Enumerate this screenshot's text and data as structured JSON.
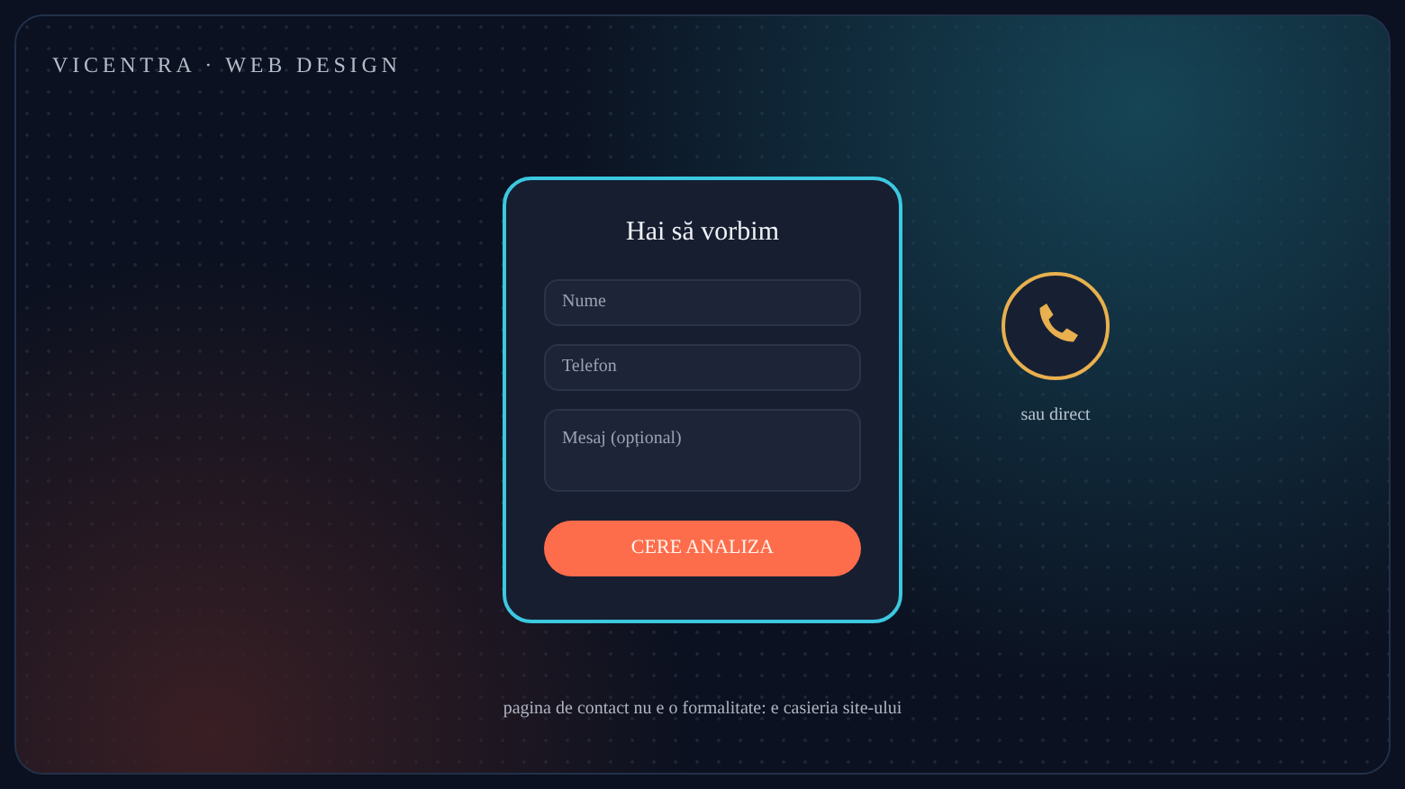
{
  "brand": "VICENTRA · WEB DESIGN",
  "form": {
    "title": "Hai să vorbim",
    "fields": [
      {
        "kind": "input",
        "placeholder": "Nume"
      },
      {
        "kind": "input",
        "placeholder": "Telefon"
      },
      {
        "kind": "textarea",
        "placeholder": "Mesaj (opțional)"
      }
    ],
    "submit": "CERE ANALIZA"
  },
  "direct": {
    "label": "sau direct"
  },
  "footer": "pagina de contact nu e o formalitate: e casieria site-ului"
}
